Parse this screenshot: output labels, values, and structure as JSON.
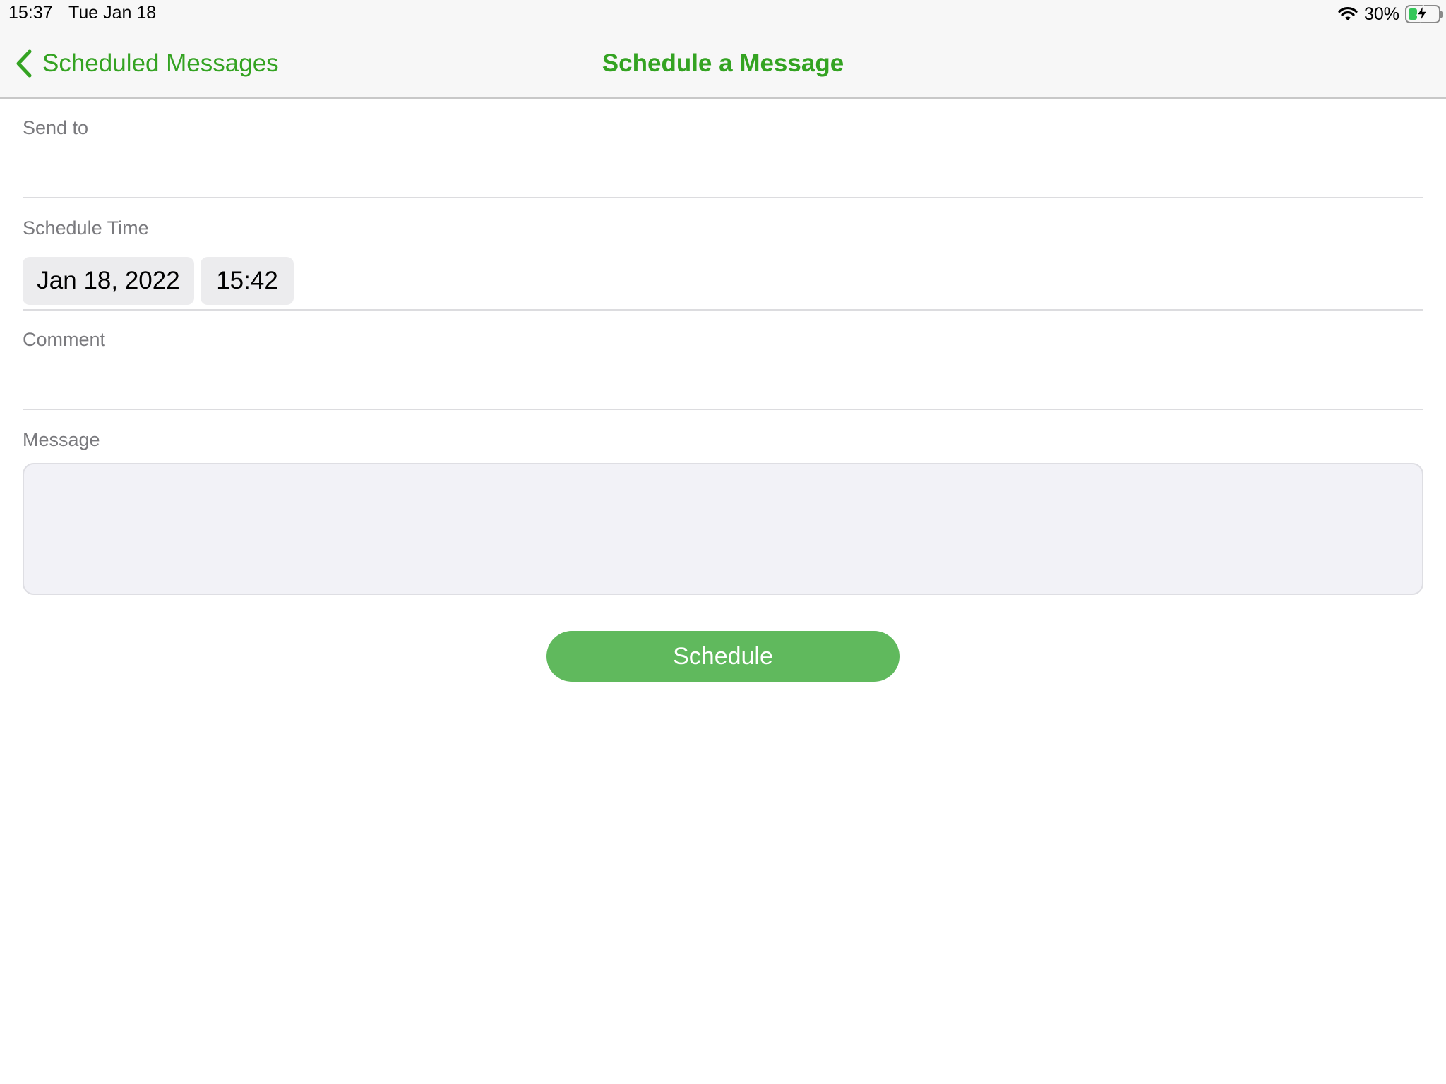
{
  "status_bar": {
    "time": "15:37",
    "date": "Tue Jan 18",
    "battery_text": "30%",
    "battery_level": 0.3,
    "charging": true
  },
  "nav": {
    "back_label": "Scheduled Messages",
    "title": "Schedule a Message"
  },
  "form": {
    "send_to_label": "Send to",
    "send_to_value": "",
    "schedule_time_label": "Schedule Time",
    "date_value": "Jan 18, 2022",
    "time_value": "15:42",
    "comment_label": "Comment",
    "comment_value": "",
    "message_label": "Message",
    "message_value": ""
  },
  "actions": {
    "schedule_label": "Schedule"
  },
  "colors": {
    "accent": "#34a322",
    "button": "#60b95d",
    "battery_fill": "#34c759"
  },
  "icons": {
    "back": "chevron-left-icon",
    "wifi": "wifi-icon",
    "battery": "battery-charging-icon"
  }
}
